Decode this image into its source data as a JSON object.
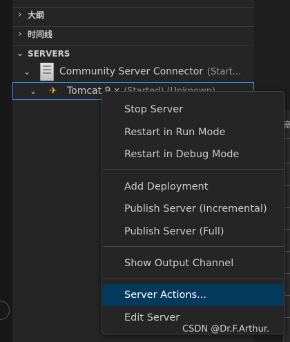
{
  "sidebar": {
    "outline_label": "大纲",
    "timeline_label": "时间线",
    "servers_label": "SERVERS",
    "connector": {
      "name": "Community Server Connector",
      "status": "(Start..."
    },
    "tomcat": {
      "name": "Tomcat 9.x",
      "status": "(Started) (Unknown)"
    }
  },
  "right_edge_char": "宽",
  "context_menu": {
    "groups": [
      [
        "Stop Server",
        "Restart in Run Mode",
        "Restart in Debug Mode"
      ],
      [
        "Add Deployment",
        "Publish Server (Incremental)",
        "Publish Server (Full)"
      ],
      [
        "Show Output Channel"
      ],
      [
        "Server Actions...",
        "Edit Server"
      ]
    ],
    "active_item": "Server Actions..."
  },
  "watermark": "CSDN @Dr.F.Arthur.",
  "colors": {
    "menu_bg": "#252526",
    "menu_active": "#04395e",
    "focus_border": "#3794ff"
  }
}
